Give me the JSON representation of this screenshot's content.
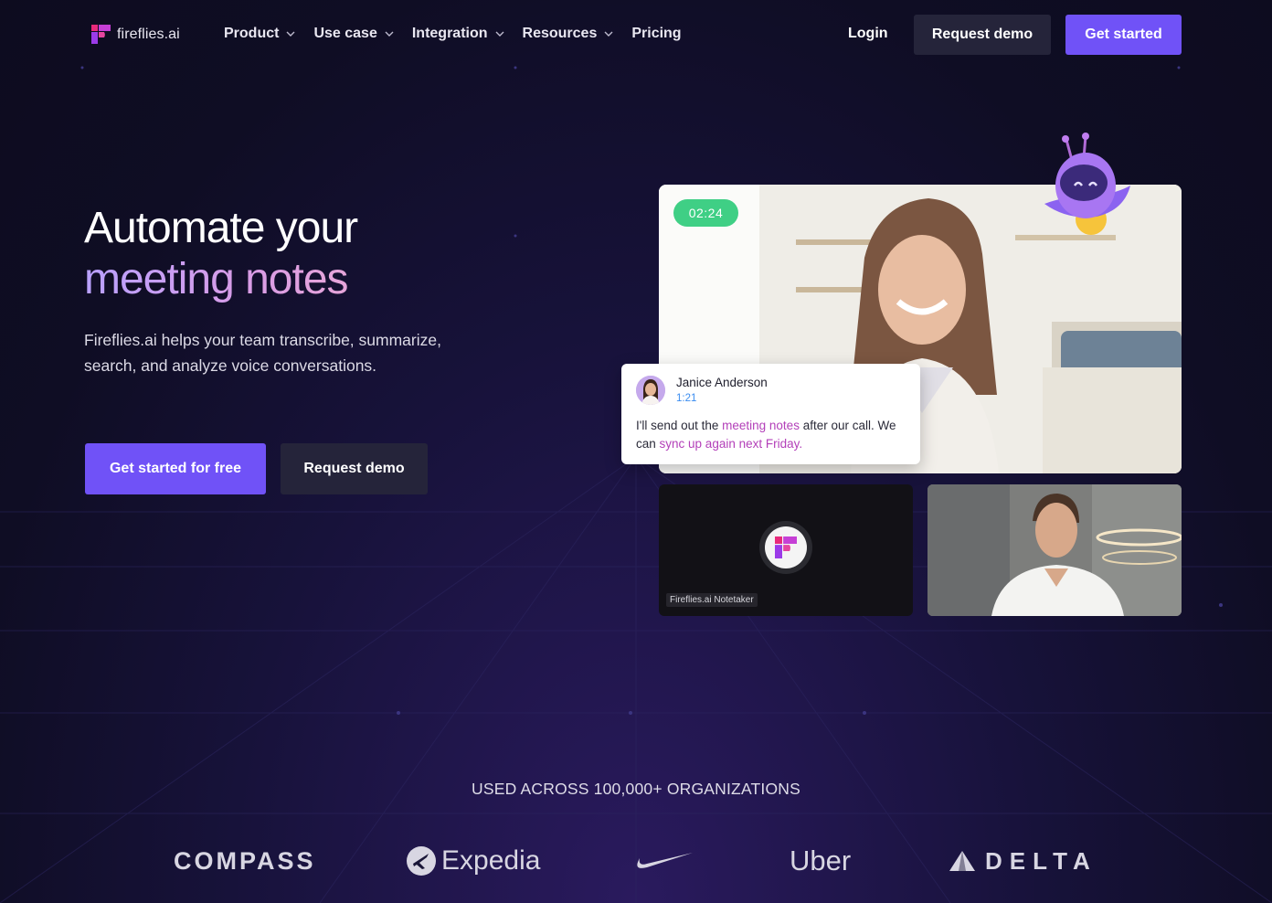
{
  "nav": {
    "logo_text": "fireflies.ai",
    "links": [
      {
        "label": "Product"
      },
      {
        "label": "Use case"
      },
      {
        "label": "Integration"
      },
      {
        "label": "Resources"
      },
      {
        "label": "Pricing"
      }
    ],
    "login_label": "Login",
    "request_demo_label": "Request demo",
    "get_started_label": "Get started"
  },
  "hero": {
    "title_line1": "Automate your",
    "title_line2": "meeting notes",
    "subtitle": "Fireflies.ai helps your team transcribe, summarize, search, and analyze voice conversations.",
    "cta_primary": "Get started for free",
    "cta_secondary": "Request demo"
  },
  "meeting": {
    "timer": "02:24",
    "speaker_name": "Janice Anderson",
    "speaker_time": "1:21",
    "transcript": {
      "part1": "I'll send out the ",
      "hl1": "meeting notes",
      "part2": " after our call. We can ",
      "hl2": "sync up again next Friday."
    },
    "notetaker_label": "Fireflies.ai Notetaker"
  },
  "social_proof": {
    "heading": "USED ACROSS 100,000+ ORGANIZATIONS",
    "brands": {
      "compass": "COMPASS",
      "expedia": "Expedia",
      "nike": "Nike",
      "uber": "Uber",
      "delta": "DELTA"
    }
  },
  "colors": {
    "accent": "#7052f7",
    "background": "#0f0d24",
    "timer_green": "#3fcf85",
    "highlight_pink": "#b340b9"
  }
}
